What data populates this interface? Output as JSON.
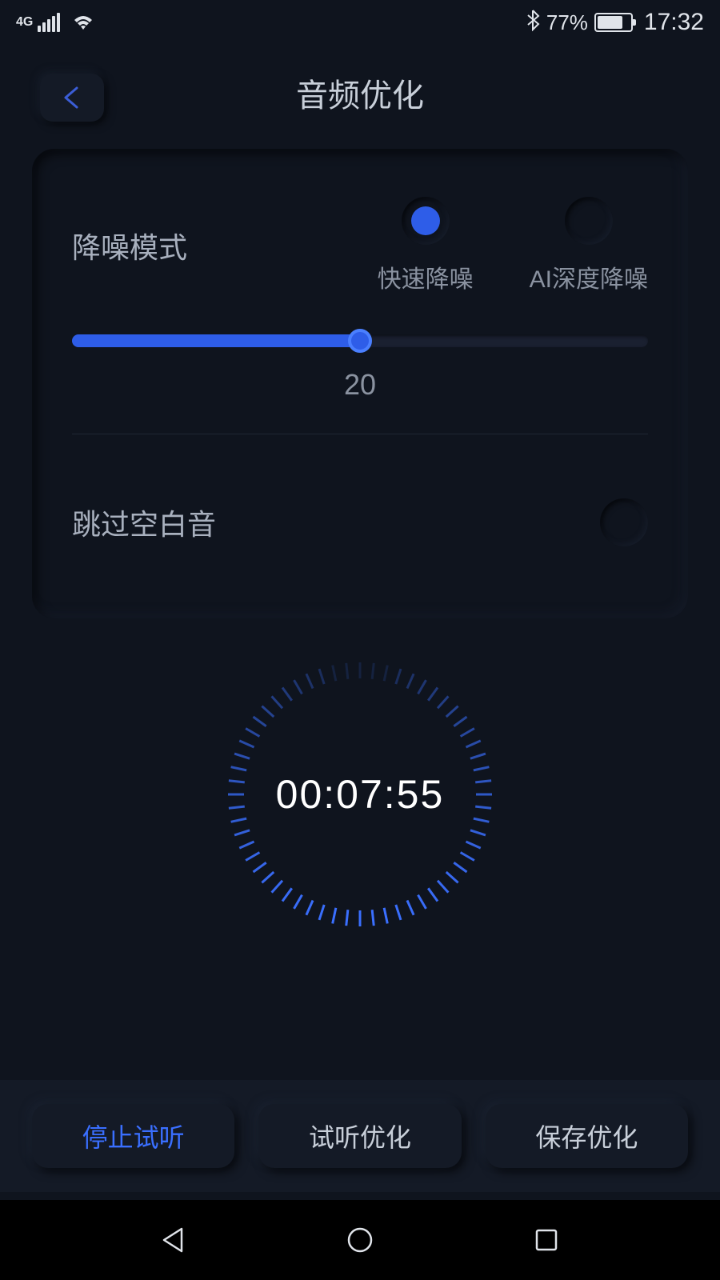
{
  "status": {
    "network": "4G",
    "bluetooth_icon": "bluetooth-icon",
    "battery_percent_text": "77%",
    "battery_percent": 77,
    "time": "17:32"
  },
  "header": {
    "back_icon": "chevron-left-icon",
    "title": "音频优化"
  },
  "noise": {
    "label": "降噪模式",
    "options": [
      {
        "label": "快速降噪",
        "selected": true
      },
      {
        "label": "AI深度降噪",
        "selected": false
      }
    ],
    "slider_value": 20,
    "slider_value_text": "20",
    "slider_percent": 50
  },
  "skip": {
    "label": "跳过空白音",
    "enabled": false
  },
  "timer": {
    "text": "00:07:55"
  },
  "actions": {
    "stop_preview": "停止试听",
    "preview_optimize": "试听优化",
    "save_optimize": "保存优化"
  }
}
